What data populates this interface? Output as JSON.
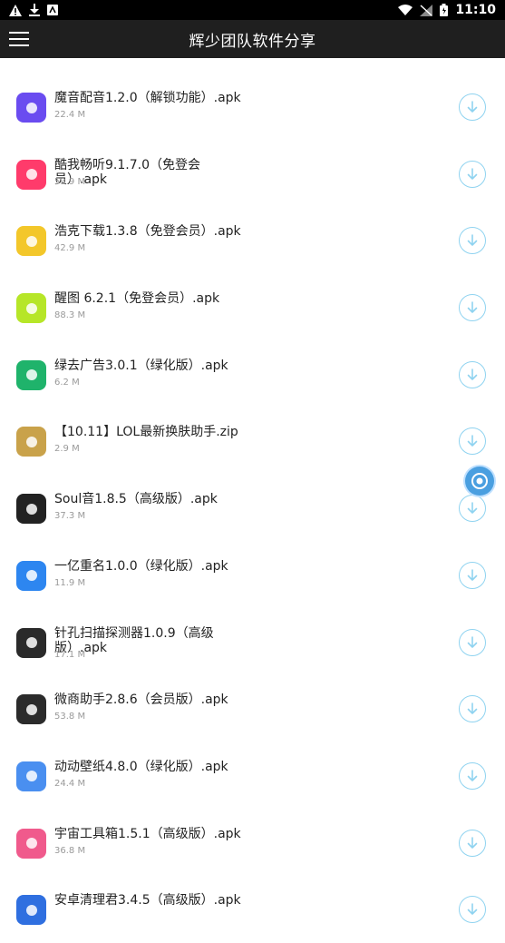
{
  "status": {
    "time": "11:10"
  },
  "header": {
    "title": "辉少团队软件分享"
  },
  "items": [
    {
      "name": "魔音配音1.2.0（解锁功能）.apk",
      "size": "22.4 M",
      "icon": "audio-wave-icon",
      "color": "#6a4cf0"
    },
    {
      "name": "酷我畅听9.1.7.0（免登会员）.apk",
      "size": "53.9 M",
      "icon": "cool-logo-icon",
      "color": "#ff3b6b"
    },
    {
      "name": "浩克下载1.3.8（免登会员）.apk",
      "size": "42.9 M",
      "icon": "hulk-icon",
      "color": "#f3c72a"
    },
    {
      "name": "醒图 6.2.1（免登会员）.apk",
      "size": "88.3 M",
      "icon": "circle-icon",
      "color": "#b6e628"
    },
    {
      "name": "绿去广告3.0.1（绿化版）.apk",
      "size": "6.2 M",
      "icon": "ad-block-icon",
      "color": "#1fb36b"
    },
    {
      "name": "【10.11】LOL最新换肤助手.zip",
      "size": "2.9 M",
      "icon": "lol-logo-icon",
      "color": "#c9a24a"
    },
    {
      "name": "Soul音1.8.5（高级版）.apk",
      "size": "37.3 M",
      "icon": "soul-icon",
      "color": "#222222"
    },
    {
      "name": "一亿重名1.0.0（绿化版）.apk",
      "size": "11.9 M",
      "icon": "1yz-icon",
      "color": "#2d86f0"
    },
    {
      "name": "针孔扫描探测器1.0.9（高级版）.apk",
      "size": "17.1 M",
      "icon": "camera-lens-icon",
      "color": "#2a2a2a"
    },
    {
      "name": "微商助手2.8.6（会员版）.apk",
      "size": "53.8 M",
      "icon": "wechat-helper-icon",
      "color": "#2b2b2b"
    },
    {
      "name": "动动壁纸4.8.0（绿化版）.apk",
      "size": "24.4 M",
      "icon": "wallpaper-icon",
      "color": "#4a8ff0"
    },
    {
      "name": "宇宙工具箱1.5.1（高级版）.apk",
      "size": "36.8 M",
      "icon": "universe-icon",
      "color": "#f05a8c"
    },
    {
      "name": "安卓清理君3.4.5（高级版）.apk",
      "size": "",
      "icon": "cleaner-icon",
      "color": "#2f6fe0"
    }
  ]
}
